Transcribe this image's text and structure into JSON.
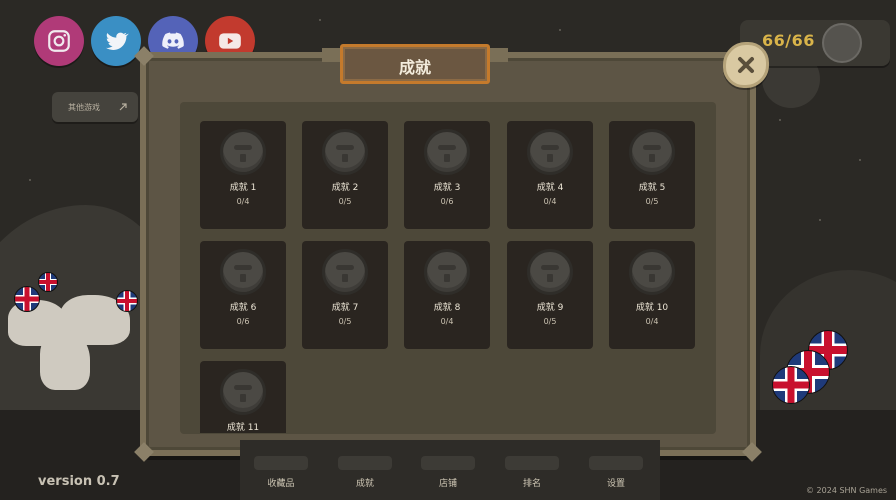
{
  "social": [
    {
      "name": "instagram",
      "color": "#b03a78"
    },
    {
      "name": "twitter",
      "color": "#3a8fc4"
    },
    {
      "name": "discord",
      "color": "#5463b8"
    },
    {
      "name": "youtube",
      "color": "#c23a2e"
    }
  ],
  "other_games": {
    "label": "其他游戏"
  },
  "counter": {
    "value": "66/66"
  },
  "modal": {
    "title": "成就"
  },
  "achievements": [
    {
      "name": "成就 1",
      "progress": "0/4"
    },
    {
      "name": "成就 2",
      "progress": "0/5"
    },
    {
      "name": "成就 3",
      "progress": "0/6"
    },
    {
      "name": "成就 4",
      "progress": "0/4"
    },
    {
      "name": "成就 5",
      "progress": "0/5"
    },
    {
      "name": "成就 6",
      "progress": "0/6"
    },
    {
      "name": "成就 7",
      "progress": "0/5"
    },
    {
      "name": "成就 8",
      "progress": "0/4"
    },
    {
      "name": "成就 9",
      "progress": "0/5"
    },
    {
      "name": "成就 10",
      "progress": "0/4"
    },
    {
      "name": "成就 11",
      "progress": ""
    }
  ],
  "nav": [
    {
      "label": "收藏品"
    },
    {
      "label": "成就"
    },
    {
      "label": "店铺"
    },
    {
      "label": "排名"
    },
    {
      "label": "设置"
    }
  ],
  "footer": {
    "version": "version 0.7",
    "copyright": "© 2024 SHN Games"
  }
}
